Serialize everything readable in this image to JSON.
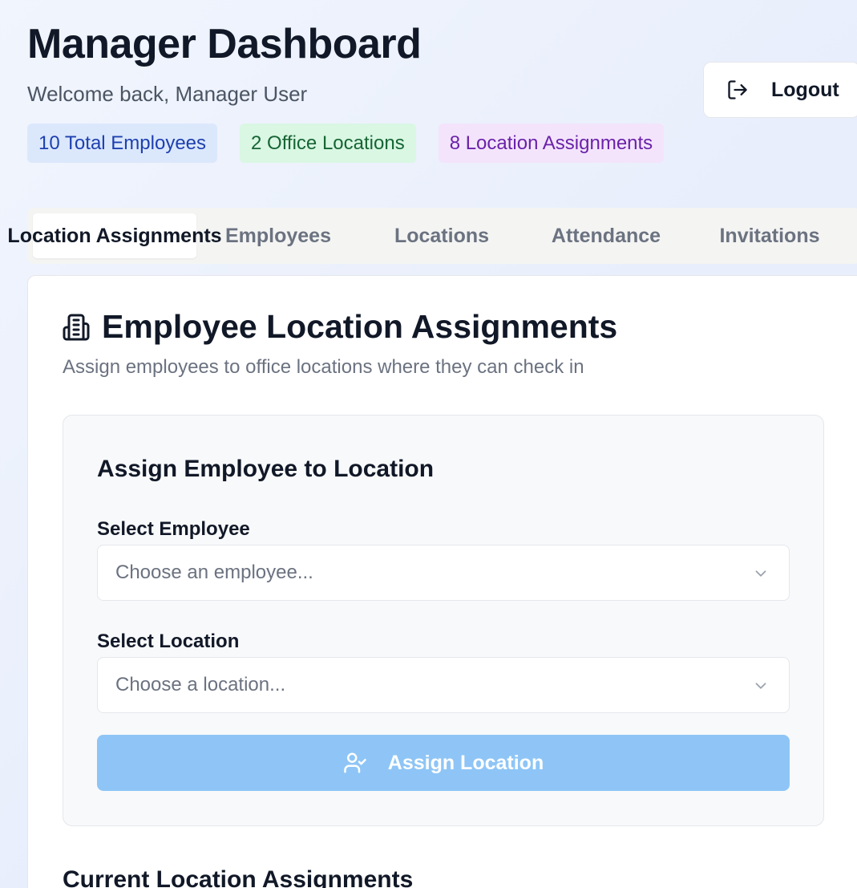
{
  "header": {
    "title": "Manager Dashboard",
    "subtitle": "Welcome back, Manager User",
    "logout_label": "Logout"
  },
  "stats": [
    {
      "label": "10 Total Employees",
      "color": "#1e40af"
    },
    {
      "label": "2 Office Locations",
      "color": "#166534"
    },
    {
      "label": "8 Location Assignments",
      "color": "#6b21a8"
    }
  ],
  "tabs": [
    {
      "label": "Location Assignments",
      "active": true
    },
    {
      "label": "Employees",
      "active": false
    },
    {
      "label": "Locations",
      "active": false
    },
    {
      "label": "Attendance",
      "active": false
    },
    {
      "label": "Invitations",
      "active": false
    }
  ],
  "card": {
    "title": "Employee Location Assignments",
    "icon": "building-icon",
    "description": "Assign employees to office locations where they can check in"
  },
  "form": {
    "title": "Assign Employee to Location",
    "employee_label": "Select Employee",
    "employee_placeholder": "Choose an employee...",
    "location_label": "Select Location",
    "location_placeholder": "Choose a location...",
    "submit_label": "Assign Location",
    "submit_icon": "user-check-icon",
    "submit_color": "#8ec5f6"
  },
  "current_section_title": "Current Location Assignments"
}
